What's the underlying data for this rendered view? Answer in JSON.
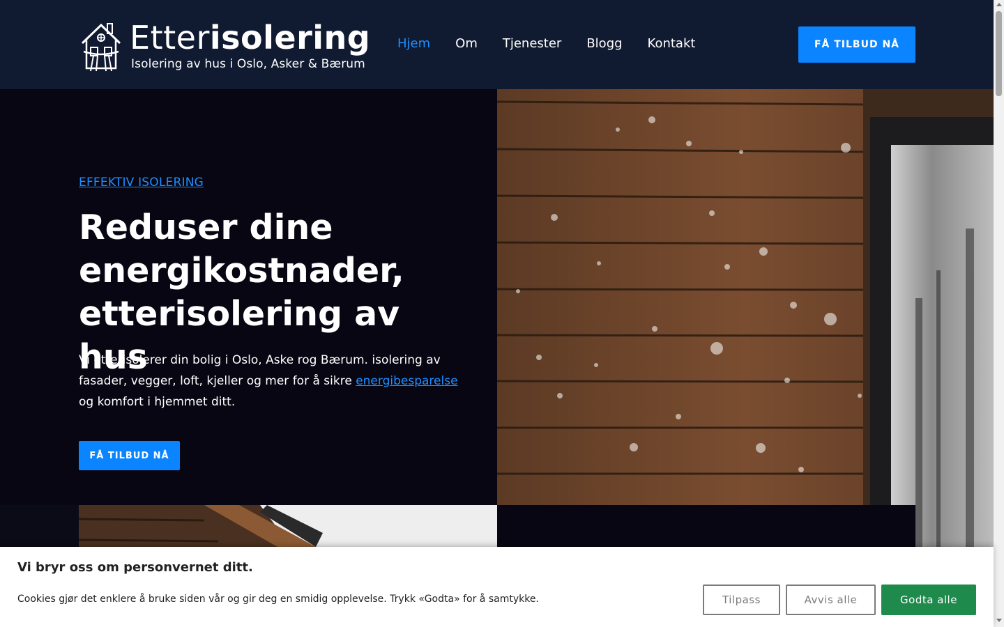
{
  "header": {
    "logo_title_light": "Etter",
    "logo_title_bold": "isolering",
    "logo_subtitle": "Isolering av hus i Oslo, Asker & Bærum",
    "nav": [
      {
        "label": "Hjem",
        "active": true
      },
      {
        "label": "Om",
        "active": false
      },
      {
        "label": "Tjenester",
        "active": false
      },
      {
        "label": "Blogg",
        "active": false
      },
      {
        "label": "Kontakt",
        "active": false
      }
    ],
    "cta_label": "FÅ TILBUD NÅ"
  },
  "hero": {
    "kicker": "EFFEKTIV ISOLERING",
    "title": "Reduser dine energikostnader, etterisolering av hus",
    "text_before_link": "Vi etterisolerer din bolig i Oslo, Aske rog Bærum. isolering av fasader, vegger, loft, kjeller og mer for å sikre ",
    "text_link": "energibesparelse",
    "text_after_link": " og komfort i hjemmet ditt.",
    "cta_label": "FÅ TILBUD NÅ"
  },
  "cookie_banner": {
    "title": "Vi bryr oss om personvernet ditt.",
    "text": "Cookies gjør det enklere å bruke siden vår og gir deg en smidig opplevelse. Trykk «Godta» for å samtykke.",
    "customize_label": "Tilpass",
    "reject_label": "Avvis alle",
    "accept_label": "Godta alle"
  },
  "colors": {
    "accent": "#0a84ff",
    "header_bg": "#101a30",
    "hero_bg": "#070612",
    "accept_green": "#1e8a4c"
  }
}
